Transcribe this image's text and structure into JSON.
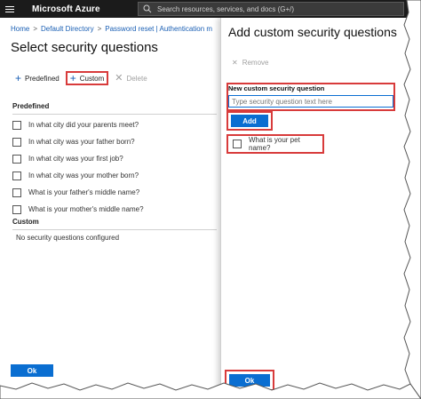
{
  "topbar": {
    "brand": "Microsoft Azure",
    "search_placeholder": "Search resources, services, and docs (G+/)"
  },
  "breadcrumb": [
    "Home",
    "Default Directory",
    "Password reset | Authentication m"
  ],
  "page_title": "Select security questions",
  "toolbar": {
    "predefined_label": "Predefined",
    "custom_label": "Custom",
    "delete_label": "Delete"
  },
  "predefined": {
    "heading": "Predefined",
    "questions": [
      "In what city did your parents meet?",
      "In what city was your father born?",
      "In what city was your first job?",
      "In what city was your mother born?",
      "What is your father's middle name?",
      "What is your mother's middle name?"
    ]
  },
  "custom": {
    "heading": "Custom",
    "empty_message": "No security questions configured"
  },
  "ok_label": "Ok",
  "panel": {
    "title": "Add custom security questions",
    "remove_label": "Remove",
    "new_question_label": "New custom security question",
    "new_question_placeholder": "Type security question text here",
    "add_label": "Add",
    "added_question": "What is your pet name?",
    "ok_label": "Ok"
  },
  "colors": {
    "topbar": "#1b1b1b",
    "accent": "#0a6ed1",
    "highlight": "#d83b3b"
  }
}
